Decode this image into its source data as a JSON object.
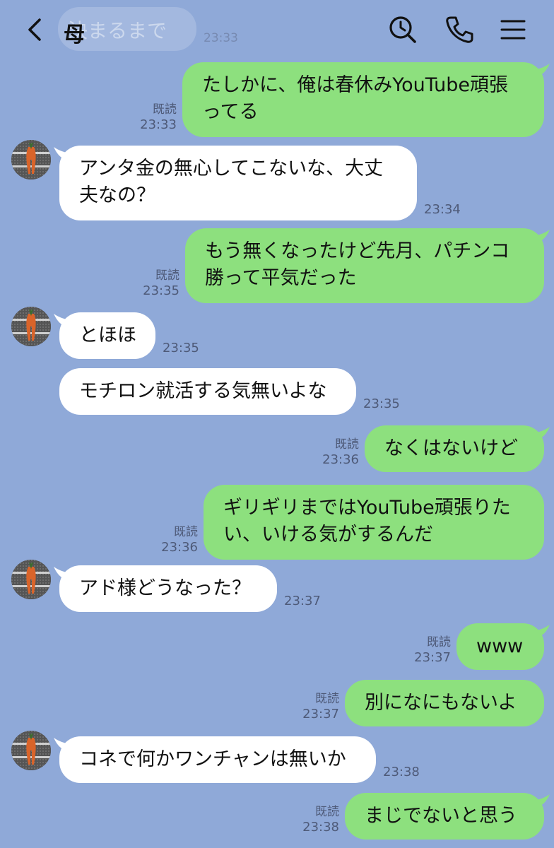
{
  "header": {
    "title": "母",
    "ghost_text": "決まるまで",
    "ghost_time": "23:33"
  },
  "messages": [
    {
      "side": "out",
      "text": "たしかに、俺は春休みYouTube頑張ってる",
      "read": "既読",
      "time": "23:33"
    },
    {
      "side": "in",
      "text": "アンタ金の無心してこないな、大丈夫なの？",
      "time": "23:34"
    },
    {
      "side": "out",
      "text": "もう無くなったけど先月、パチンコ勝って平気だった",
      "read": "既読",
      "time": "23:35"
    },
    {
      "side": "in",
      "text": "とほほ",
      "time": "23:35"
    },
    {
      "side": "in",
      "text": "モチロン就活する気無いよな",
      "time": "23:35"
    },
    {
      "side": "out",
      "text": "なくはないけど",
      "read": "既読",
      "time": "23:36"
    },
    {
      "side": "out",
      "text": "ギリギリまではYouTube頑張りたい、いける気がするんだ",
      "read": "既読",
      "time": "23:36"
    },
    {
      "side": "in",
      "text": "アド様どうなった？",
      "time": "23:37"
    },
    {
      "side": "out",
      "text": "www",
      "read": "既読",
      "time": "23:37"
    },
    {
      "side": "out",
      "text": "別になにもないよ",
      "read": "既読",
      "time": "23:37"
    },
    {
      "side": "in",
      "text": "コネで何かワンチャンは無いか",
      "time": "23:38"
    },
    {
      "side": "out",
      "text": "まじでないと思う",
      "read": "既読",
      "time": "23:38"
    }
  ],
  "colors": {
    "background": "#8fa9d8",
    "incoming": "#ffffff",
    "outgoing": "#8de07e"
  },
  "icons": [
    "back-chevron-icon",
    "search-history-icon",
    "phone-icon",
    "menu-icon"
  ]
}
